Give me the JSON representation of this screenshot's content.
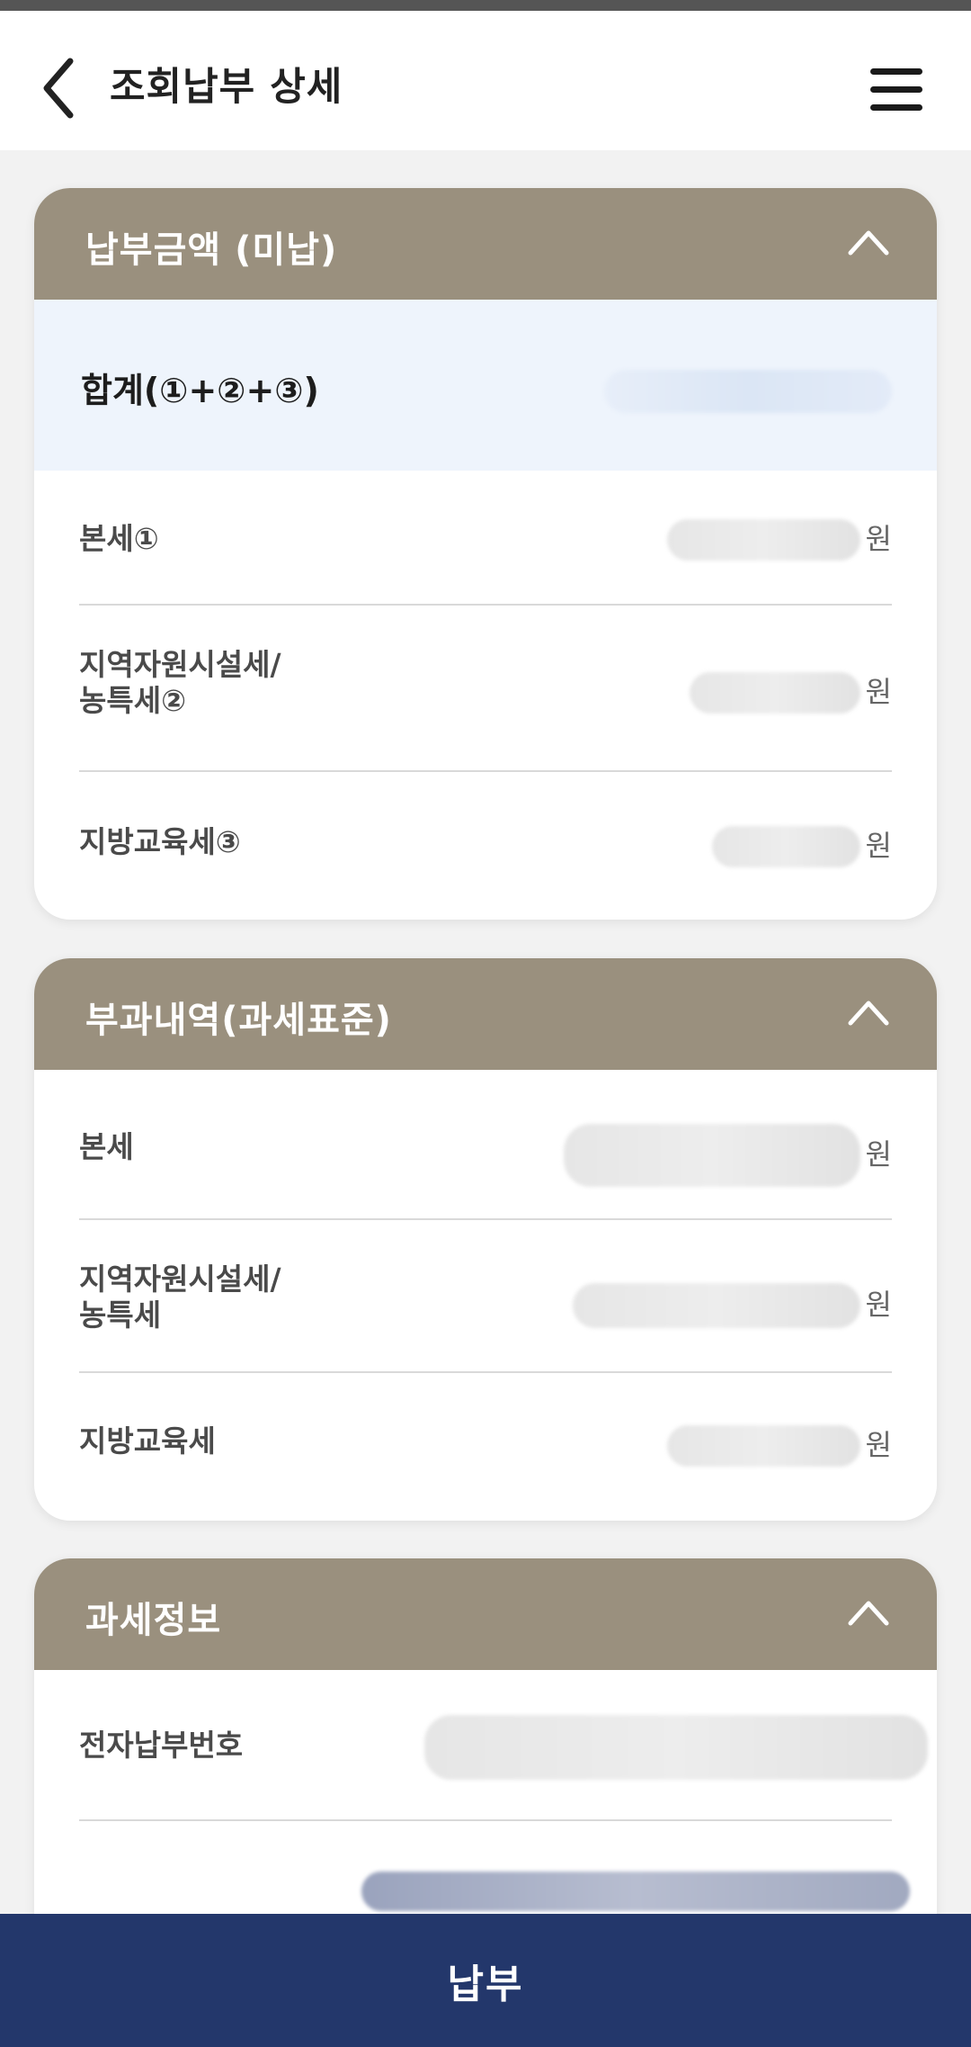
{
  "header": {
    "title": "조회납부 상세",
    "back_icon": "chevron-left-icon",
    "menu_icon": "hamburger-menu-icon"
  },
  "payment_amount": {
    "title": "납부금액 (미납)",
    "total_label": "합계(①+②+③)",
    "rows": [
      {
        "label": "본세①",
        "unit": "원"
      },
      {
        "label_line1": "지역자원시설세/",
        "label_line2": "농특세②",
        "unit": "원"
      },
      {
        "label": "지방교육세③",
        "unit": "원"
      }
    ]
  },
  "levy_details": {
    "title": "부과내역(과세표준)",
    "rows": [
      {
        "label": "본세",
        "unit": "원"
      },
      {
        "label_line1": "지역자원시설세/",
        "label_line2": "농특세",
        "unit": "원"
      },
      {
        "label": "지방교육세",
        "unit": "원"
      }
    ]
  },
  "tax_info": {
    "title": "과세정보",
    "rows": [
      {
        "label": "전자납부번호"
      }
    ]
  },
  "pay_button": {
    "label": "납부"
  },
  "colors": {
    "card_header": "#9a907e",
    "total_bg": "#eef4fc",
    "pay_bar": "#23376b"
  }
}
